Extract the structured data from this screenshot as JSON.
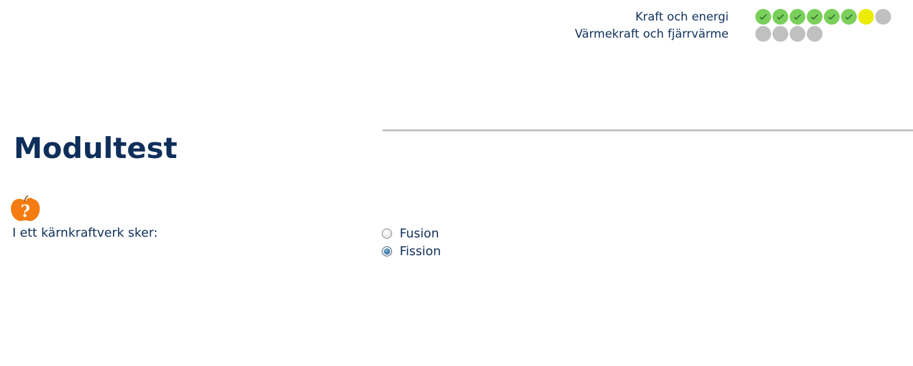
{
  "progress": {
    "modules": [
      {
        "label": "Kraft och energi",
        "steps": [
          "done",
          "done",
          "done",
          "done",
          "done",
          "done",
          "current",
          "todo"
        ]
      },
      {
        "label": "Värmekraft och fjärrvärme",
        "steps": [
          "todo",
          "todo",
          "todo",
          "todo"
        ]
      }
    ]
  },
  "page": {
    "title": "Modultest"
  },
  "question": {
    "icon": "question-apple-icon",
    "text": "I ett kärnkraftverk sker:",
    "options": [
      {
        "label": "Fusion",
        "selected": false
      },
      {
        "label": "Fission",
        "selected": true
      }
    ]
  },
  "colors": {
    "text": "#0f2f5a",
    "done": "#7bcf5b",
    "current": "#ecec00",
    "todo": "#c0c0c0",
    "icon": "#f47c12"
  }
}
